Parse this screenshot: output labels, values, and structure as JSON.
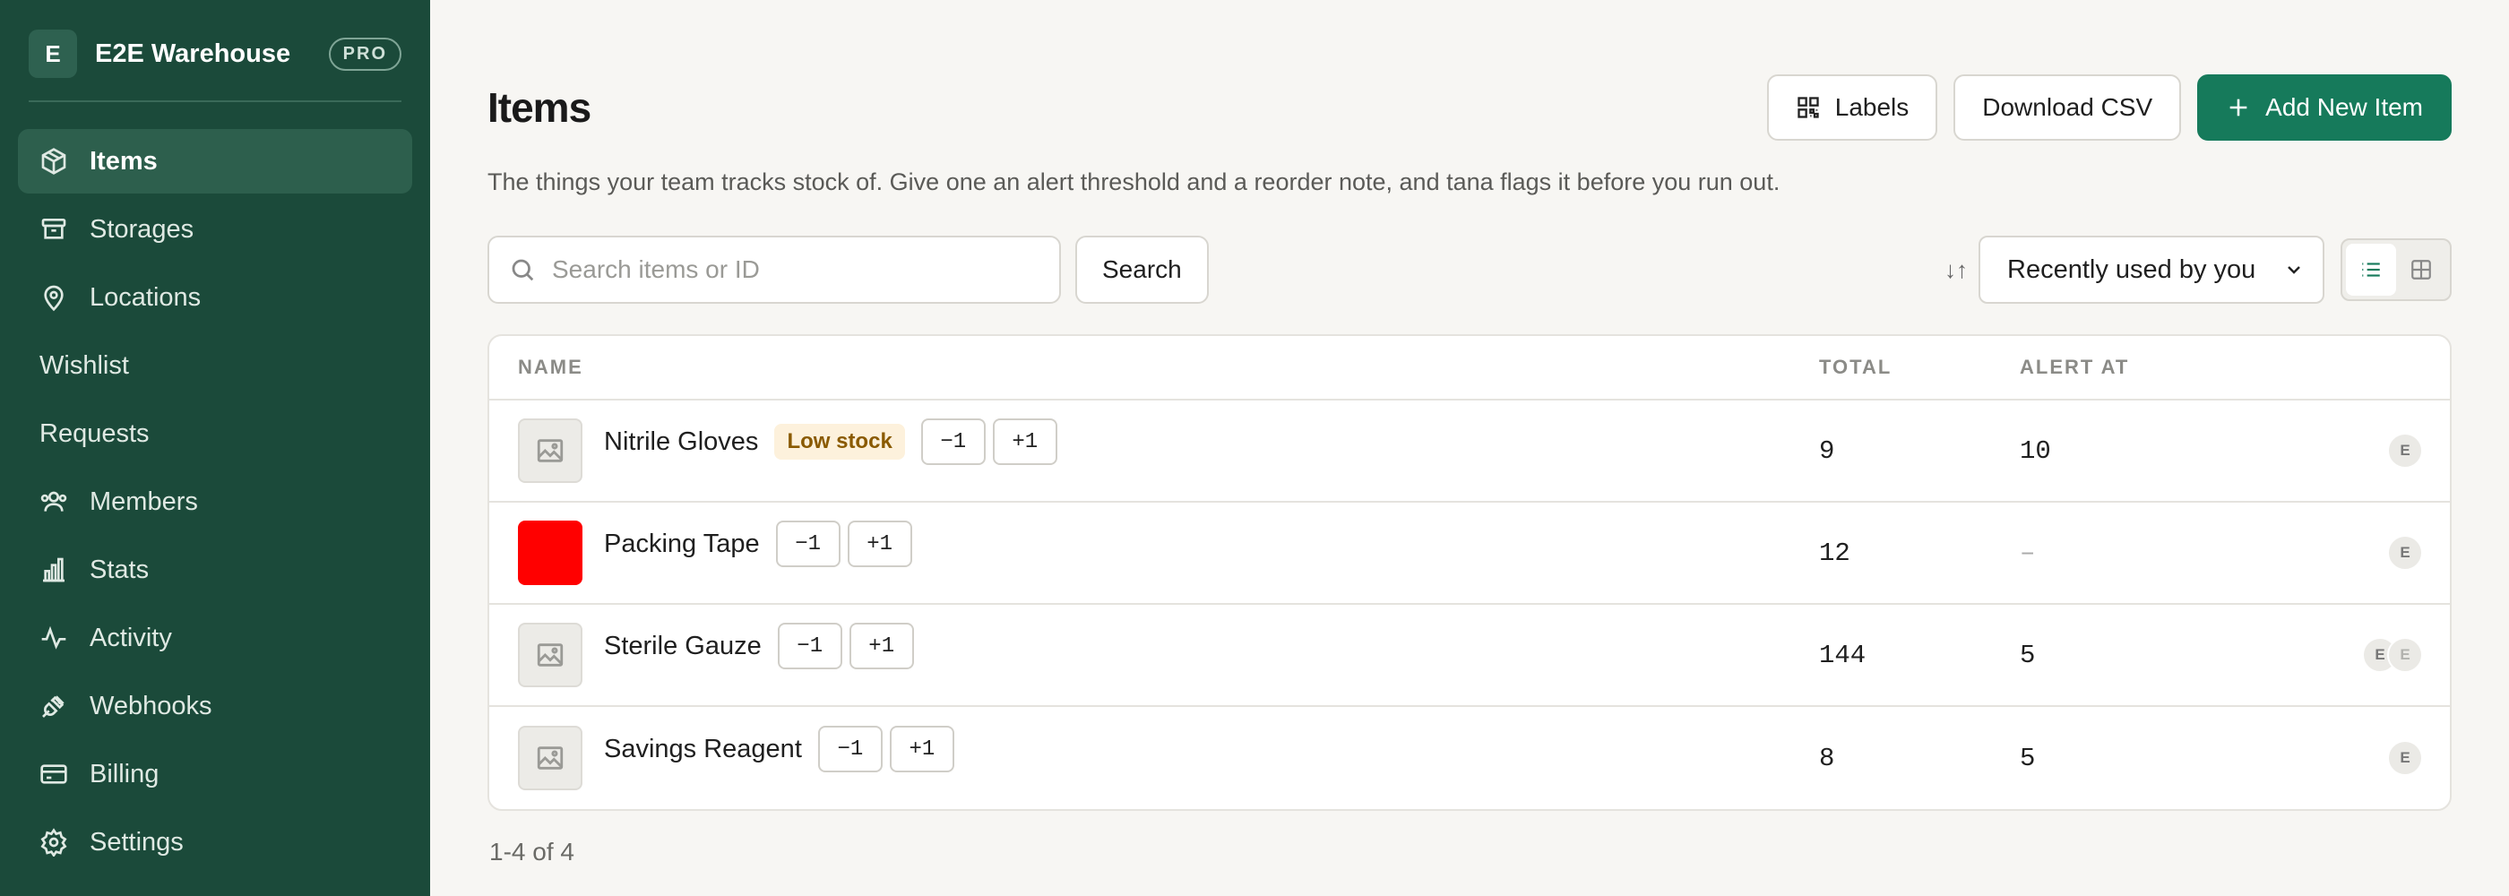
{
  "workspace": {
    "initial": "E",
    "name": "E2E Warehouse",
    "plan_badge": "PRO"
  },
  "sidebar": {
    "items": [
      {
        "label": "Items",
        "icon": "box-icon",
        "active": true
      },
      {
        "label": "Storages",
        "icon": "archive-icon"
      },
      {
        "label": "Locations",
        "icon": "map-pin-icon"
      },
      {
        "label": "Wishlist",
        "icon": ""
      },
      {
        "label": "Requests",
        "icon": ""
      },
      {
        "label": "Members",
        "icon": "users-icon"
      },
      {
        "label": "Stats",
        "icon": "bar-chart-icon"
      },
      {
        "label": "Activity",
        "icon": "activity-icon"
      },
      {
        "label": "Webhooks",
        "icon": "plug-icon"
      },
      {
        "label": "Billing",
        "icon": "credit-card-icon"
      },
      {
        "label": "Settings",
        "icon": "gear-icon"
      }
    ]
  },
  "header": {
    "title": "Items",
    "labels_button": "Labels",
    "download_button": "Download CSV",
    "add_button": "Add New Item",
    "subtitle": "The things your team tracks stock of. Give one an alert threshold and a reorder note, and tana flags it before you run out."
  },
  "toolbar": {
    "search_placeholder": "Search items or ID",
    "search_button": "Search",
    "sort_icon": "↓↑",
    "sort_value": "Recently used by you",
    "view_mode": "list"
  },
  "table": {
    "columns": {
      "name": "NAME",
      "total": "TOTAL",
      "alert": "ALERT AT"
    },
    "rows": [
      {
        "name": "Nitrile Gloves",
        "badge": "Low stock",
        "thumb": "image",
        "total": "9",
        "alert": "10",
        "users": [
          "E"
        ]
      },
      {
        "name": "Packing Tape",
        "badge": "",
        "thumb": "#ff0000",
        "total": "12",
        "alert": "–",
        "users": [
          "E"
        ]
      },
      {
        "name": "Sterile Gauze",
        "badge": "",
        "thumb": "image",
        "total": "144",
        "alert": "5",
        "users": [
          "E",
          "E"
        ]
      },
      {
        "name": "Savings Reagent",
        "badge": "",
        "thumb": "image",
        "total": "8",
        "alert": "5",
        "users": [
          "E"
        ]
      }
    ],
    "stepper": {
      "minus": "−1",
      "plus": "+1"
    }
  },
  "footer": {
    "count": "1-4 of 4"
  },
  "colors": {
    "sidebar_bg": "#1b4a3a",
    "primary": "#167a5b",
    "low_stock_bg": "#fdf1dc",
    "low_stock_text": "#8a5a00"
  }
}
